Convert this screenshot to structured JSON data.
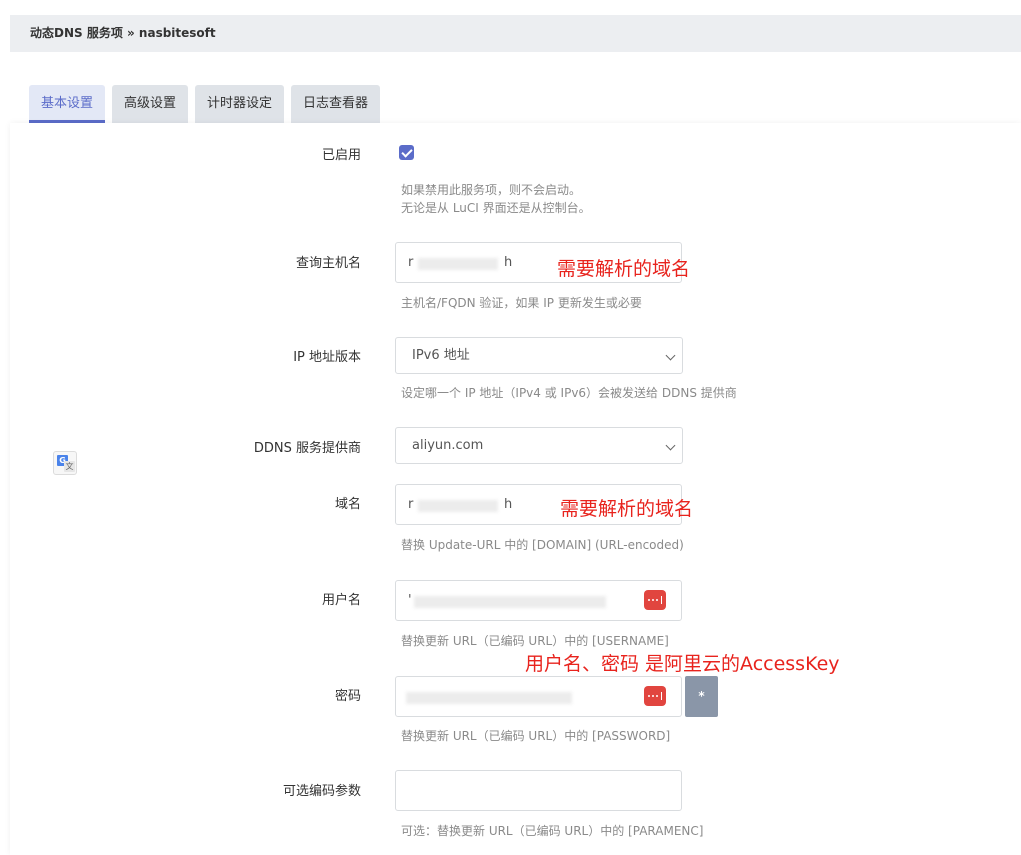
{
  "breadcrumb": "动态DNS 服务项 » nasbitesoft",
  "tabs": [
    {
      "label": "基本设置",
      "active": true
    },
    {
      "label": "高级设置",
      "active": false
    },
    {
      "label": "计时器设定",
      "active": false
    },
    {
      "label": "日志查看器",
      "active": false
    }
  ],
  "colors": {
    "accent": "#5b6cc9",
    "annotation": "#e8231d",
    "password_badge": "#e1453f"
  },
  "fields": {
    "enabled": {
      "label": "已启用",
      "checked": true,
      "help_line1": "如果禁用此服务项，则不会启动。",
      "help_line2": "无论是从 LuCI 界面还是从控制台。"
    },
    "lookup_host": {
      "label": "查询主机名",
      "value_prefix": "r",
      "value_suffix": "h",
      "help": "主机名/FQDN 验证，如果 IP 更新发生或必要"
    },
    "ip_version": {
      "label": "IP 地址版本",
      "selected": "IPv6 地址",
      "help": "设定哪一个 IP 地址（IPv4 或 IPv6）会被发送给 DDNS 提供商"
    },
    "provider": {
      "label": "DDNS 服务提供商",
      "selected": "aliyun.com"
    },
    "domain": {
      "label": "域名",
      "value_prefix": "r",
      "value_suffix": "h",
      "help": "替换 Update-URL 中的 [DOMAIN] (URL-encoded)"
    },
    "username": {
      "label": "用户名",
      "value_prefix": "'",
      "help": "替换更新 URL（已编码 URL）中的 [USERNAME]"
    },
    "password": {
      "label": "密码",
      "reveal_label": "*",
      "help": "替换更新 URL（已编码 URL）中的 [PASSWORD]"
    },
    "param_enc": {
      "label": "可选编码参数",
      "value": "",
      "help": "可选：替换更新 URL（已编码 URL）中的 [PARAMENC]"
    }
  },
  "annotations": {
    "lookup_host": "需要解析的域名",
    "domain": "需要解析的域名",
    "credentials": "用户名、密码 是阿里云的AccessKey"
  },
  "icons": {
    "translate": "google-translate-icon",
    "password": "password-manager-icon",
    "dropdown": "chevron-down-icon",
    "checkbox": "checkmark-icon"
  }
}
